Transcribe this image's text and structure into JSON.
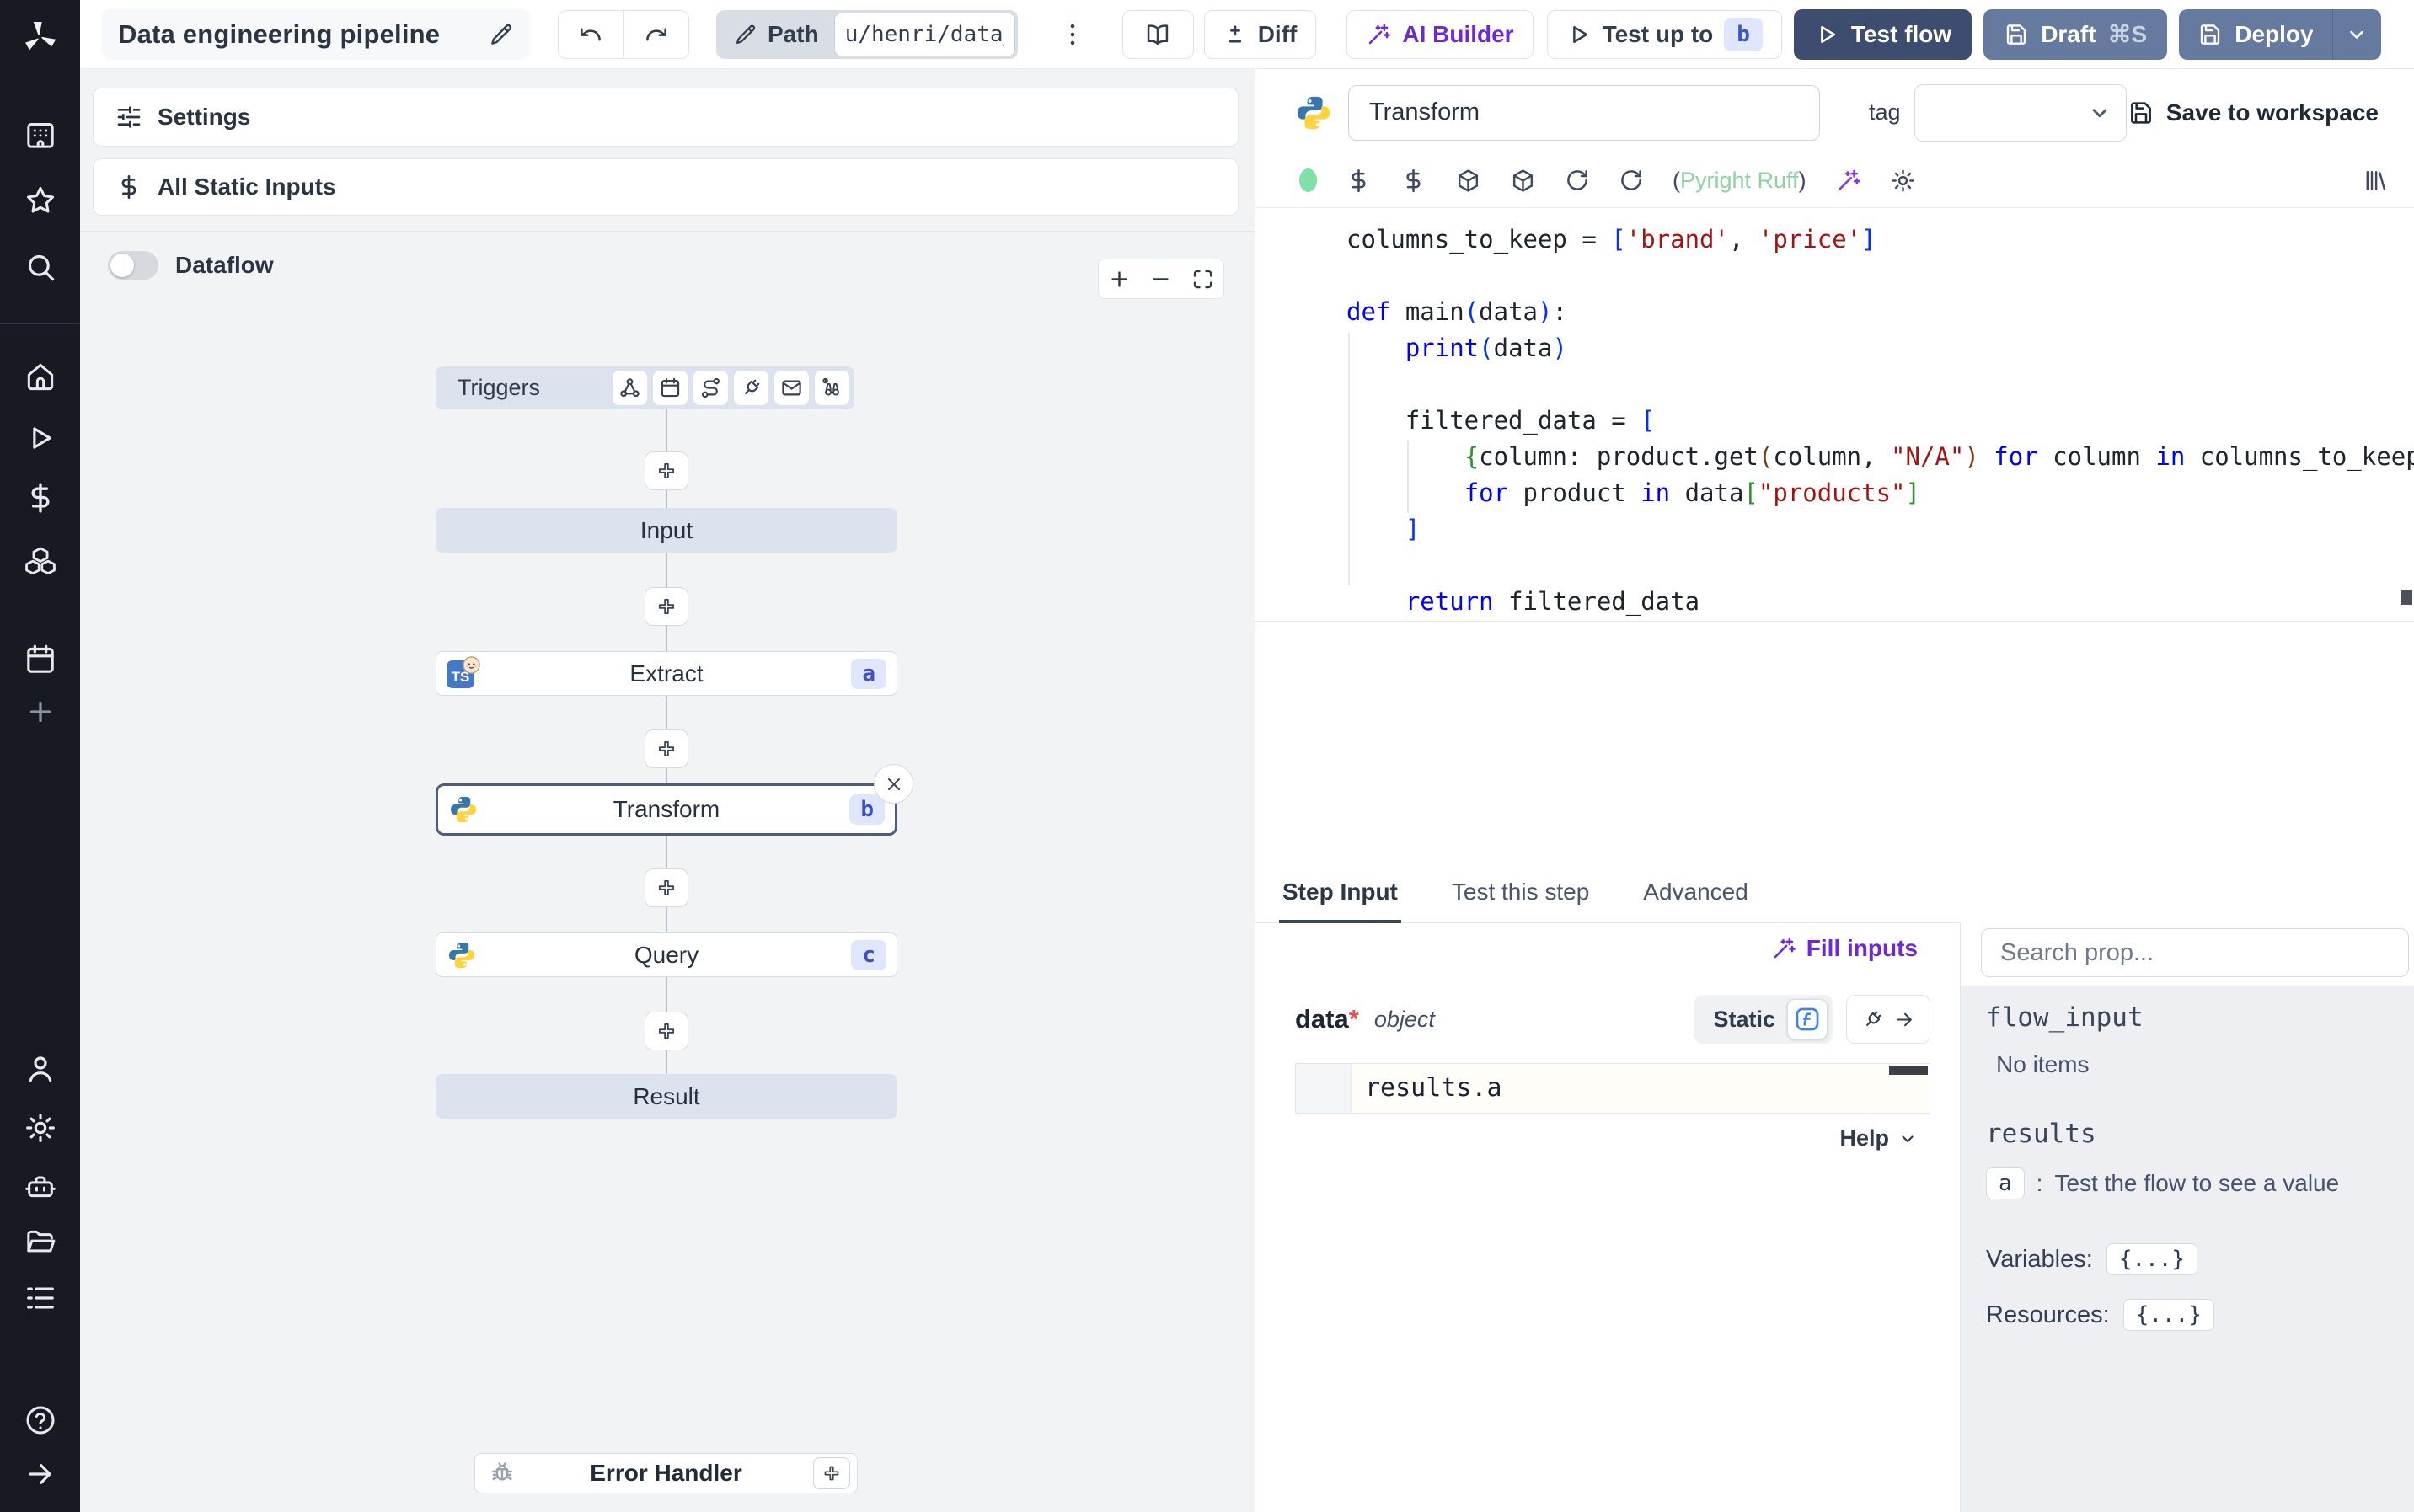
{
  "topbar": {
    "title": "Data engineering pipeline",
    "path_label": "Path",
    "path_value": "u/henri/data_",
    "diff_label": "Diff",
    "ai_builder_label": "AI Builder",
    "test_up_to_label": "Test up to",
    "test_up_to_badge": "b",
    "test_flow_label": "Test flow",
    "draft_label": "Draft",
    "draft_shortcut": "⌘S",
    "deploy_label": "Deploy"
  },
  "sidebar": {
    "icons": [
      "windmill-logo",
      "workspace",
      "favorites",
      "search",
      "home",
      "runs",
      "variables",
      "resources",
      "schedules",
      "add",
      "account",
      "settings",
      "workers",
      "folders",
      "audit-logs",
      "help",
      "collapse"
    ]
  },
  "left_panel": {
    "settings_label": "Settings",
    "all_static_inputs_label": "All Static Inputs",
    "dataflow_label": "Dataflow"
  },
  "flow": {
    "triggers_label": "Triggers",
    "trigger_icons": [
      "webhook-icon",
      "schedule-icon",
      "route-icon",
      "websocket-icon",
      "email-icon",
      "poll-icon"
    ],
    "nodes": [
      {
        "label": "Input"
      },
      {
        "label": "Extract",
        "badge": "a",
        "language": "bun-typescript"
      },
      {
        "label": "Transform",
        "badge": "b",
        "language": "python",
        "selected": true
      },
      {
        "label": "Query",
        "badge": "c",
        "language": "python"
      },
      {
        "label": "Result"
      }
    ],
    "error_handler_label": "Error Handler"
  },
  "editor": {
    "step_name": "Transform",
    "tag_label": "tag",
    "save_label": "Save to workspace",
    "lint_open": "(",
    "lint_name": "Pyright Ruff",
    "lint_close": ")"
  },
  "code": {
    "language": "python",
    "lines": [
      [
        {
          "c": "pl",
          "t": "columns_to_keep = "
        },
        {
          "c": "b0",
          "t": "["
        },
        {
          "c": "str",
          "t": "'brand'"
        },
        {
          "c": "pl",
          "t": ", "
        },
        {
          "c": "str",
          "t": "'price'"
        },
        {
          "c": "b0",
          "t": "]"
        }
      ],
      [],
      [
        {
          "c": "kw",
          "t": "def"
        },
        {
          "c": "pl",
          "t": " main"
        },
        {
          "c": "b0",
          "t": "("
        },
        {
          "c": "pl",
          "t": "data"
        },
        {
          "c": "b0",
          "t": ")"
        },
        {
          "c": "pl",
          "t": ":"
        }
      ],
      [
        {
          "c": "pl",
          "t": "    "
        },
        {
          "c": "kw",
          "t": "print"
        },
        {
          "c": "b0",
          "t": "("
        },
        {
          "c": "pl",
          "t": "data"
        },
        {
          "c": "b0",
          "t": ")"
        }
      ],
      [],
      [
        {
          "c": "pl",
          "t": "    filtered_data = "
        },
        {
          "c": "b0",
          "t": "["
        }
      ],
      [
        {
          "c": "pl",
          "t": "        "
        },
        {
          "c": "b1",
          "t": "{"
        },
        {
          "c": "pl",
          "t": "column: product.get"
        },
        {
          "c": "b2",
          "t": "("
        },
        {
          "c": "pl",
          "t": "column, "
        },
        {
          "c": "str",
          "t": "\"N/A\""
        },
        {
          "c": "b2",
          "t": ")"
        },
        {
          "c": "pl",
          "t": " "
        },
        {
          "c": "kw",
          "t": "for"
        },
        {
          "c": "pl",
          "t": " column "
        },
        {
          "c": "kw",
          "t": "in"
        },
        {
          "c": "pl",
          "t": " columns_to_keep"
        },
        {
          "c": "b1",
          "t": "}"
        }
      ],
      [
        {
          "c": "pl",
          "t": "        "
        },
        {
          "c": "kw",
          "t": "for"
        },
        {
          "c": "pl",
          "t": " product "
        },
        {
          "c": "kw",
          "t": "in"
        },
        {
          "c": "pl",
          "t": " data"
        },
        {
          "c": "b1",
          "t": "["
        },
        {
          "c": "str",
          "t": "\"products\""
        },
        {
          "c": "b1",
          "t": "]"
        }
      ],
      [
        {
          "c": "pl",
          "t": "    "
        },
        {
          "c": "b0",
          "t": "]"
        }
      ],
      [],
      [
        {
          "c": "pl",
          "t": "    "
        },
        {
          "c": "kw",
          "t": "return"
        },
        {
          "c": "pl",
          "t": " filtered_data"
        }
      ]
    ]
  },
  "tabs": [
    {
      "label": "Step Input",
      "active": true
    },
    {
      "label": "Test this step",
      "active": false
    },
    {
      "label": "Advanced",
      "active": false
    }
  ],
  "step_input": {
    "fill_inputs_label": "Fill inputs",
    "field_name": "data",
    "required_mark": "*",
    "field_type": "object",
    "static_label": "Static",
    "expr_value": "results.a",
    "help_label": "Help"
  },
  "prop_picker": {
    "search_placeholder": "Search prop...",
    "flow_input_label": "flow_input",
    "no_items_label": "No items",
    "results_label": "results",
    "result_key": "a",
    "result_separator": ":",
    "result_hint": "Test the flow to see a value",
    "variables_label": "Variables:",
    "variables_value": "{...}",
    "resources_label": "Resources:",
    "resources_value": "{...}"
  },
  "colors": {
    "accent_purple": "#6d28d9",
    "test_flow_button": "#3e4c6f",
    "deploy_button": "#66799f",
    "node_bar_bg": "#dde3ee",
    "badge_bg": "#e0e6fc",
    "badge_text": "#3d51c5",
    "lint_ok_text": "#8ed2a4",
    "status_dot": "#7fe0a8",
    "python_blue": "#3776ab",
    "python_yellow": "#ffd43b",
    "sidebar_bg": "#171a21"
  }
}
